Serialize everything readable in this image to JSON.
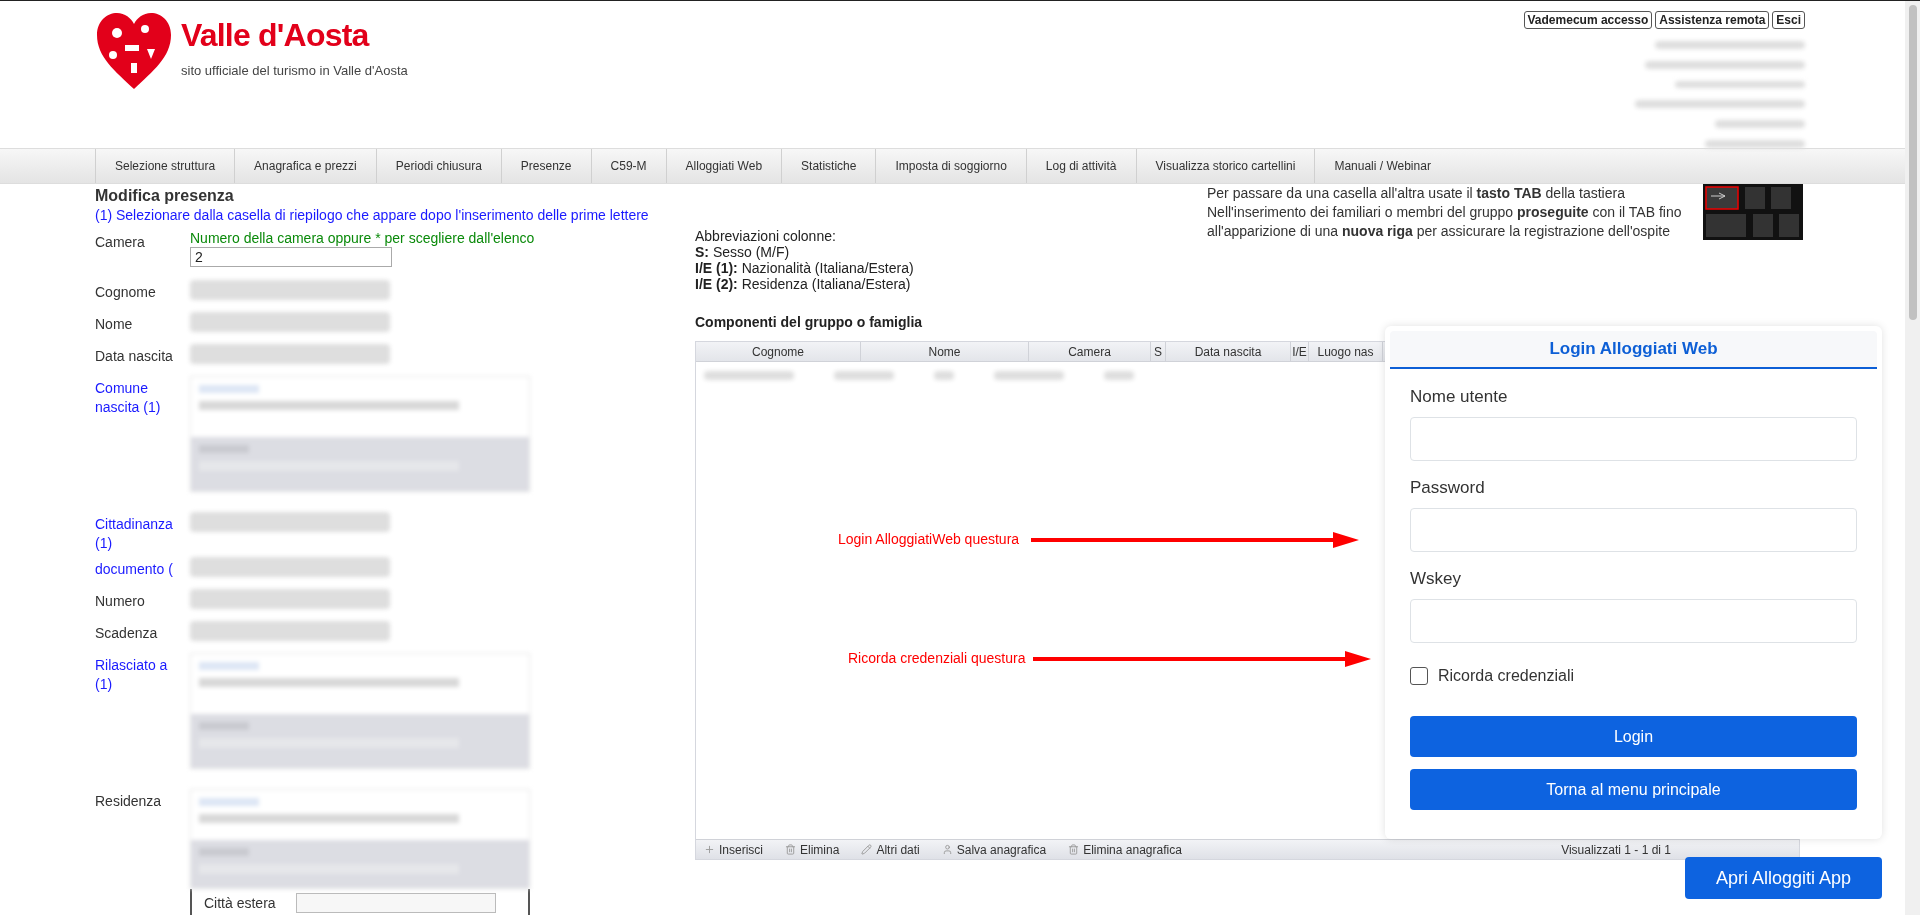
{
  "header": {
    "logo_text": "Valle d'Aosta",
    "tagline": "sito ufficiale del turismo in Valle d'Aosta",
    "links": [
      "Vademecum accesso",
      "Assistenza remota",
      "Esci"
    ]
  },
  "nav": {
    "items": [
      {
        "label": "Selezione struttura"
      },
      {
        "label": "Anagrafica e prezzi"
      },
      {
        "label": "Periodi chiusura"
      },
      {
        "label": "Presenze"
      },
      {
        "label": "C59-M"
      },
      {
        "label": "Alloggiati Web"
      },
      {
        "label": "Statistiche"
      },
      {
        "label": "Imposta di soggiorno"
      },
      {
        "label": "Log di attività"
      },
      {
        "label": "Visualizza storico cartellini"
      },
      {
        "label": "Manuali / Webinar"
      }
    ]
  },
  "tip": {
    "lines": [
      "Per passare da una casella all'altra usate il **tasto TAB** della tastiera",
      "Nell'inserimento dei familiari o membri del gruppo **proseguite** con il TAB fino",
      "all'apparizione di una **nuova riga** per assicurare la registrazione dell'ospite"
    ]
  },
  "form": {
    "title": "Modifica presenza",
    "hint": "(1) Selezionare dalla casella di riepilogo che appare dopo l'inserimento delle prime lettere",
    "fields": [
      {
        "label": "Camera",
        "kind": "input",
        "link": false,
        "hint": "Numero della camera oppure * per scegliere dall'elenco",
        "value": "2"
      },
      {
        "label": "Cognome",
        "kind": "redacted",
        "link": false
      },
      {
        "label": "Nome",
        "kind": "redacted",
        "link": false
      },
      {
        "label": "Data nascita",
        "kind": "redacted",
        "link": false
      },
      {
        "label": "Comune nascita (1)",
        "kind": "place",
        "link": true
      },
      {
        "label": "Cittadinanza (1)",
        "kind": "redacted",
        "link": true
      },
      {
        "label": "documento (",
        "kind": "redacted",
        "link": true
      },
      {
        "label": "Numero",
        "kind": "redacted",
        "link": false
      },
      {
        "label": "Scadenza",
        "kind": "redacted",
        "link": false
      },
      {
        "label": "Rilasciato a (1)",
        "kind": "place",
        "link": true
      },
      {
        "label": "Residenza",
        "kind": "residence",
        "link": false,
        "foreign_city": "Città estera"
      }
    ]
  },
  "abbreviations": {
    "title": "Abbreviazioni colonne:",
    "items": [
      {
        "key": "S:",
        "text": "Sesso (M/F)"
      },
      {
        "key": "I/E (1):",
        "text": "Nazionalità (Italiana/Estera)"
      },
      {
        "key": "I/E (2):",
        "text": "Residenza (Italiana/Estera)"
      }
    ]
  },
  "group": {
    "title": "Componenti del gruppo o famiglia",
    "columns": [
      "Cognome",
      "Nome",
      "Camera",
      "S",
      "Data nascita",
      "I/E",
      "Luogo nas"
    ],
    "toolbar": [
      {
        "label": "Inserisci",
        "kind": "add"
      },
      {
        "label": "Elimina",
        "kind": "delete"
      },
      {
        "label": "Altri dati",
        "kind": "edit"
      },
      {
        "label": "Salva anagrafica",
        "kind": "user"
      },
      {
        "label": "Elimina anagrafica",
        "kind": "delete"
      }
    ],
    "pager": "Visualizzati 1 - 1 di 1"
  },
  "annotations": [
    {
      "text": "Login AlloggiatiWeb questura"
    },
    {
      "text": "Ricorda credenziali questura"
    }
  ],
  "login": {
    "title": "Login Alloggiati Web",
    "fields": [
      {
        "label": "Nome utente"
      },
      {
        "label": "Password"
      },
      {
        "label": "Wskey"
      }
    ],
    "remember": {
      "label": "Ricorda credenziali",
      "checked": false
    },
    "buttons": [
      "Login",
      "Torna al menu principale"
    ]
  },
  "app_button": "Apri Alloggiti App"
}
